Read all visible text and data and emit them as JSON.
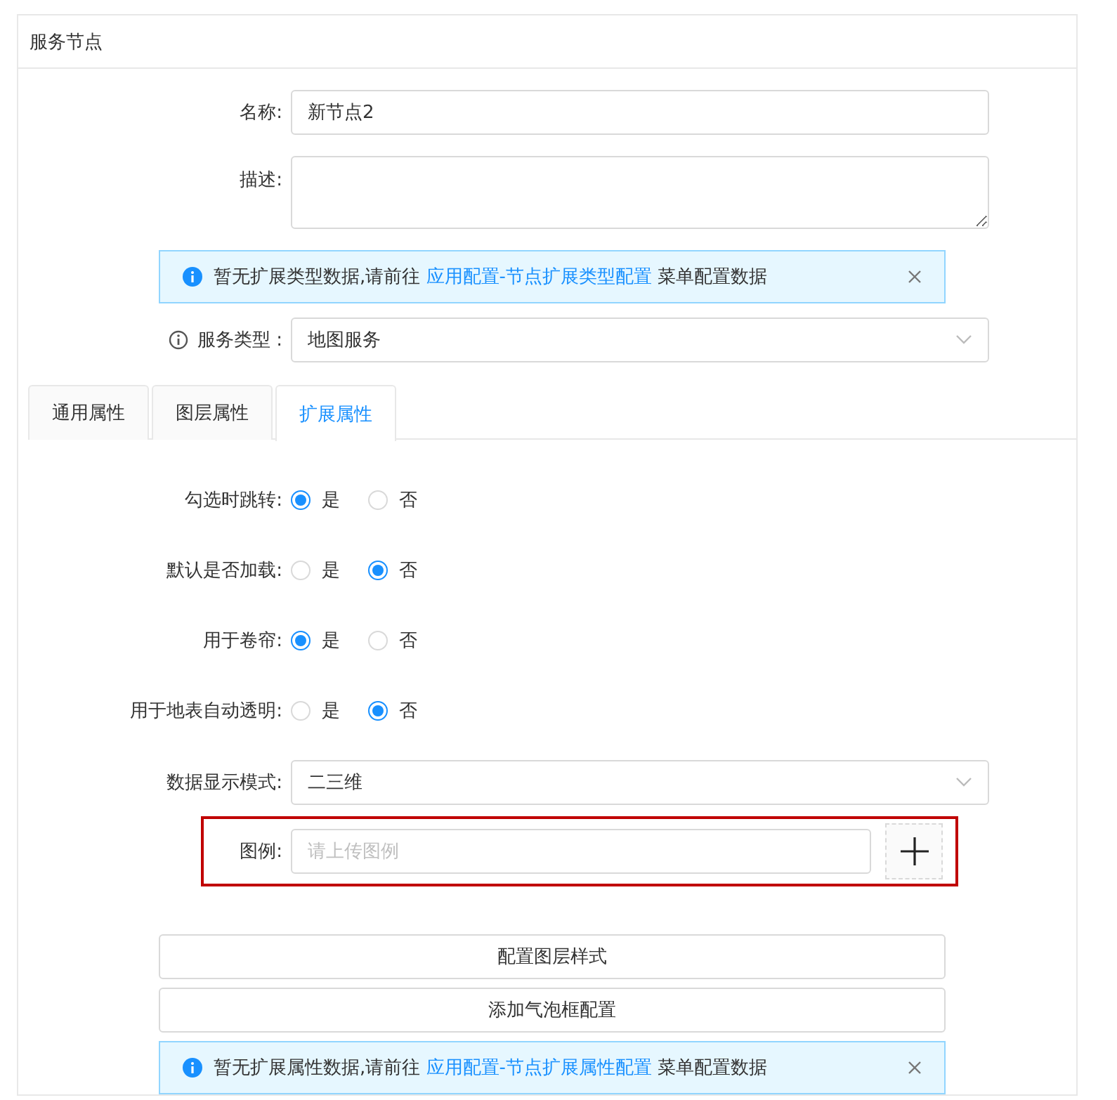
{
  "card": {
    "title": "服务节点"
  },
  "fields": [
    {
      "kind": "text",
      "label": "名称:",
      "value": "新节点2"
    },
    {
      "kind": "textarea",
      "label": "描述:"
    },
    {
      "kind": "alert",
      "prefix": "暂无扩展类型数据,请前往 ",
      "link": "应用配置-节点扩展类型配置",
      "suffix": " 菜单配置数据"
    },
    {
      "kind": "select",
      "label": "服务类型 :",
      "info": true,
      "value": "地图服务"
    }
  ],
  "tabs": [
    {
      "label": "通用属性",
      "selected": false
    },
    {
      "label": "图层属性",
      "selected": false
    },
    {
      "label": "扩展属性",
      "selected": true
    }
  ],
  "extension_fields": [
    {
      "kind": "radio",
      "label": "勾选时跳转:",
      "options": [
        {
          "label": "是",
          "selected": true
        },
        {
          "label": "否",
          "selected": false
        }
      ]
    },
    {
      "kind": "radio",
      "label": "默认是否加载:",
      "options": [
        {
          "label": "是",
          "selected": false
        },
        {
          "label": "否",
          "selected": true
        }
      ]
    },
    {
      "kind": "radio",
      "label": "用于卷帘:",
      "options": [
        {
          "label": "是",
          "selected": true
        },
        {
          "label": "否",
          "selected": false
        }
      ]
    },
    {
      "kind": "radio",
      "label": "用于地表自动透明:",
      "options": [
        {
          "label": "是",
          "selected": false
        },
        {
          "label": "否",
          "selected": true
        }
      ]
    },
    {
      "kind": "select",
      "label": "数据显示模式:",
      "value": "二三维"
    },
    {
      "kind": "upload",
      "label": "图例:",
      "placeholder": "请上传图例",
      "highlighted": true
    },
    {
      "kind": "button",
      "label": "配置图层样式"
    },
    {
      "kind": "button",
      "label": "添加气泡框配置"
    },
    {
      "kind": "alert",
      "prefix": "暂无扩展属性数据,请前往 ",
      "link": "应用配置-节点扩展属性配置",
      "suffix": " 菜单配置数据"
    }
  ]
}
